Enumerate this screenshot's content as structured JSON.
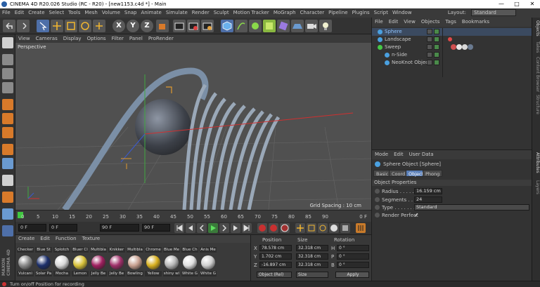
{
  "window": {
    "title": "CINEMA 4D R20.026 Studio (RC - R20) - [new1153.c4d *] - Main",
    "minimize": "—",
    "maximize": "□",
    "close": "✕"
  },
  "menu": [
    "File",
    "Edit",
    "Create",
    "Select",
    "Tools",
    "Mesh",
    "Volume",
    "Snap",
    "Animate",
    "Simulate",
    "Render",
    "Sculpt",
    "Motion Tracker",
    "MoGraph",
    "Character",
    "Pipeline",
    "Plugins",
    "Script",
    "Window"
  ],
  "layout": {
    "label": "Layout:",
    "value": "Standard"
  },
  "viewport": {
    "menu": [
      "View",
      "Cameras",
      "Display",
      "Options",
      "Filter",
      "Panel",
      "ProRender"
    ],
    "label": "Perspective",
    "grid_spacing": "Grid Spacing : 10 cm"
  },
  "toolbar_axes": [
    "X",
    "Y",
    "Z"
  ],
  "timeline": {
    "ticks": [
      "0",
      "5",
      "10",
      "15",
      "20",
      "25",
      "30",
      "35",
      "40",
      "45",
      "50",
      "55",
      "60",
      "65",
      "70",
      "75",
      "80",
      "85",
      "90"
    ],
    "end_frame": "0 F"
  },
  "transport": {
    "current": "0 F",
    "start": "0 F",
    "end1": "90 F",
    "end2": "90 F"
  },
  "materials": {
    "menu": [
      "Create",
      "Edit",
      "Function",
      "Texture"
    ],
    "row1": [
      "Checker",
      "Blue St",
      "Splotch",
      "Bluer Cl",
      "Multibla",
      "Knikker",
      "Multibla",
      "Chrome",
      "Blue Me",
      "Blue Ch",
      "Anis Me"
    ],
    "row2": [
      {
        "name": "Vulcani",
        "color": "#8a8a8a"
      },
      {
        "name": "Solar Pa",
        "color": "#1c2f6b"
      },
      {
        "name": "Mocha",
        "color": "#d8d8d8"
      },
      {
        "name": "Lemon",
        "color": "#d8c23a"
      },
      {
        "name": "Jelly Be",
        "color": "#a02060"
      },
      {
        "name": "Jelly Be",
        "color": "#a0306a"
      },
      {
        "name": "Bowling",
        "color": "#c8a090"
      },
      {
        "name": "Yellow",
        "color": "#d8b020"
      },
      {
        "name": "shiny wl",
        "color": "#b8b8b8"
      },
      {
        "name": "White G",
        "color": "#e0e0e0"
      },
      {
        "name": "White G",
        "color": "#cfcfcf"
      }
    ]
  },
  "coords": {
    "headers": [
      "Position",
      "Size",
      "Rotation"
    ],
    "rows": [
      {
        "axis": "X",
        "pos": "78.578 cm",
        "size": "32.318 cm",
        "rot_axis": "H",
        "rot": "0 °"
      },
      {
        "axis": "Y",
        "pos": "1.702 cm",
        "size": "32.318 cm",
        "rot_axis": "P",
        "rot": "0 °"
      },
      {
        "axis": "Z",
        "pos": "-16.897 cm",
        "size": "32.318 cm",
        "rot_axis": "B",
        "rot": "0 °"
      }
    ],
    "mode": "Object (Rel)",
    "size_mode": "Size",
    "apply": "Apply"
  },
  "objects": {
    "menu": [
      "File",
      "Edit",
      "View",
      "Objects",
      "Tags",
      "Bookmarks"
    ],
    "items": [
      {
        "name": "Sphere",
        "indent": 0,
        "color": "#4aa0e0",
        "selected": true
      },
      {
        "name": "Landscape",
        "indent": 0,
        "color": "#4aa0e0",
        "selected": false
      },
      {
        "name": "Sweep",
        "indent": 0,
        "color": "#46c846",
        "selected": false
      },
      {
        "name": "n-Side",
        "indent": 1,
        "color": "#4aa0e0",
        "selected": false
      },
      {
        "name": "NeoKnot Object",
        "indent": 1,
        "color": "#4aa0e0",
        "selected": false
      }
    ]
  },
  "attributes": {
    "menu": [
      "Mode",
      "Edit",
      "User Data"
    ],
    "title": "Sphere Object [Sphere]",
    "tabs": [
      "Basic",
      "Coord.",
      "Object",
      "Phong"
    ],
    "active_tab": "Object",
    "section": "Object Properties",
    "radius_label": "Radius . . . . . . . . .",
    "radius": "16.159 cm",
    "segments_label": "Segments . . . . . .",
    "segments": "24",
    "type_label": "Type . . . . . . . . . .",
    "type": "Standard",
    "render_perfect_label": "Render Perfect",
    "render_perfect": "✓"
  },
  "right_tabs": [
    "Objects",
    "Takes",
    "Content Browser",
    "Structure",
    "Attributes",
    "Layers"
  ],
  "status": "Turn on/off Position for recording"
}
